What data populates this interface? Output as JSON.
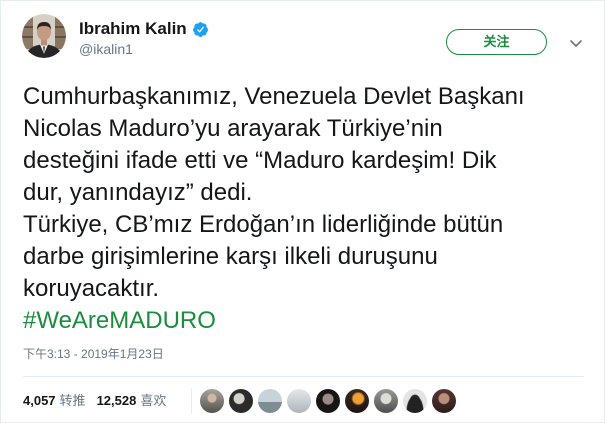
{
  "author": {
    "name": "Ibrahim Kalin",
    "handle": "@ikalin1",
    "verified": true,
    "avatar_icon": "profile-photo"
  },
  "follow_button": {
    "label": "关注"
  },
  "menu_icon": "chevron-down",
  "tweet": {
    "lines": [
      "Cumhurbaşkanımız, Venezuela Devlet Başkanı",
      "Nicolas Maduro’yu arayarak Türkiye’nin",
      "desteğini ifade etti ve “Maduro kardeşim! Dik",
      "dur, yanındayız” dedi.",
      "Türkiye, CB’mız Erdoğan’ın liderliğinde bütün",
      "darbe girişimlerine karşı ilkeli duruşunu",
      "koruyacaktır."
    ],
    "hashtag": "#WeAreMADURO"
  },
  "timestamp": "下午3:13 - 2019年1月23日",
  "stats": {
    "retweets": {
      "count": "4,057",
      "label": "转推"
    },
    "likes": {
      "count": "12,528",
      "label": "喜欢"
    }
  },
  "colors": {
    "link": "#1c8c3e",
    "verified": "#1da1f2",
    "text": "#14171a",
    "muted": "#657786",
    "divider": "#e6ecf0"
  }
}
